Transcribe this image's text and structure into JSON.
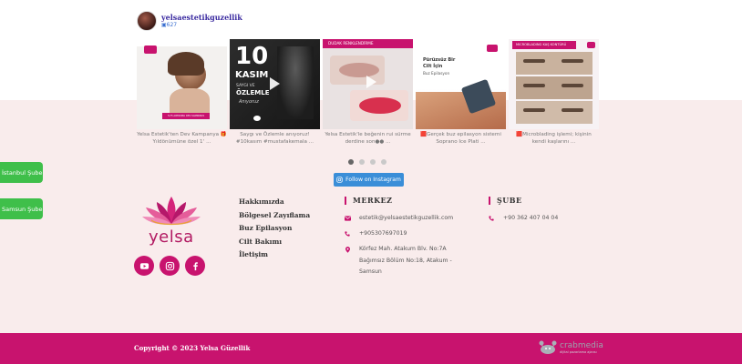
{
  "instagram": {
    "username": "yelsaestetikguzellik",
    "post_count": "627",
    "posts": [
      {
        "caption_line1": "Yelsa Estetik'ten Dev Kampanya 🎁",
        "caption_line2": "Yıldönümüne özel 1ʼ ..."
      },
      {
        "caption_line1": "Saygı ve Özlemle anıyoruz!",
        "caption_line2": "#10kasım #mustafakemala ..."
      },
      {
        "caption_line1": "Yelsa Estetik'le beğenin rui sürme",
        "caption_line2": "derdine son●● ..."
      },
      {
        "caption_line1": "🟥Gerçek buz epilasyon sistemi",
        "caption_line2": "Soprano Ice Plati ..."
      },
      {
        "caption_line1": "🟥Microblading işlemi; kişinin",
        "caption_line2": "kendi kaşlarını ..."
      }
    ],
    "thumb_text": {
      "p1_banner": "%75 ARTIRIMLI DEV KAMPANYA",
      "p2_big": "10",
      "p2_line1": "KASIM",
      "p2_line2": "SAYGI VE",
      "p2_line3": "ÖZLEMLE",
      "p2_line4": "Anıyoruz",
      "p3_header": "DUDAK RENKLENDİRME",
      "p4_line1": "Pürüzsüz Bir",
      "p4_line2": "Cilt İçin",
      "p4_line3": "Buz Epilasyon",
      "p5_header": "MICROBLADING KAŞ KONTÜRÜ"
    },
    "follow_label": "Follow on Instagram",
    "active_dot": 0,
    "dot_count": 4
  },
  "branches": {
    "istanbul": "İstanbul Şube",
    "samsun": "Samsun Şube"
  },
  "logo": {
    "text": "yelsa"
  },
  "links": [
    "Hakkımızda",
    "Bölgesel Zayıflama",
    "Buz Epilasyon",
    "Cilt Bakımı",
    "İletişim"
  ],
  "merkez": {
    "title": "MERKEZ",
    "email": "estetik@yelsaestetikguzellik.com",
    "phone": "+905307697019",
    "address_line1": "Körfez Mah. Atakum Blv. No:7A",
    "address_line2": "Bağımsız Bölüm No:18, Atakum -",
    "address_line3": "Samsun"
  },
  "sube": {
    "title": "ŞUBE",
    "phone": "+90 362 407 04 04"
  },
  "footer": {
    "copyright": "Copyright © 2023 Yelsa Güzellik",
    "brand_name": "crabmedia",
    "brand_sub": "dijital pazarlama ajansı"
  },
  "colors": {
    "brand_pink": "#c8136e",
    "branch_green": "#3fbf4a",
    "follow_blue": "#3a8ed8",
    "page_pink": "#f9ecec"
  }
}
